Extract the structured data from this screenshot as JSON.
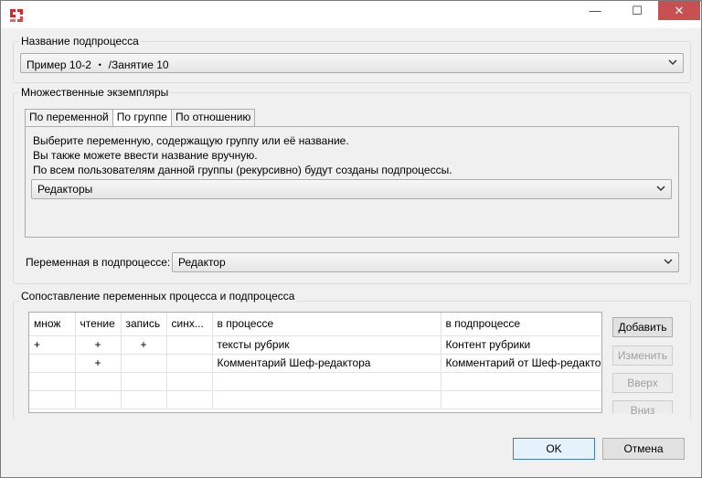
{
  "window": {
    "icon": "app-logo-icon",
    "controls": {
      "minimize": "—",
      "maximize": "☐",
      "close": "✕"
    }
  },
  "subprocess_name": {
    "title": "Название подпроцесса",
    "value": "Пример 10-2  ・ /Занятие 10"
  },
  "multi_instances": {
    "title": "Множественные экземпляры",
    "tabs": [
      "По переменной",
      "По группе",
      "По отношению"
    ],
    "active_tab": "По группе",
    "text_lines": [
      "Выберите переменную, содержащую группу или её название.",
      "Вы также можете ввести название вручную.",
      "По всем пользователям данной группы (рекурсивно) будут созданы подпроцессы."
    ],
    "group_value": "Редакторы",
    "variable_label": "Переменная в подпроцессе:",
    "variable_value": "Редактор"
  },
  "mapping": {
    "title": "Сопоставление переменных процесса и подпроцесса",
    "columns": [
      "множ",
      "чтение",
      "запись",
      "синх...",
      "в процессе",
      "в подпроцессе"
    ],
    "rows": [
      [
        "+",
        "+",
        "+",
        "",
        "тексты рубрик",
        "Контент рубрики"
      ],
      [
        "",
        "+",
        "",
        "",
        "Комментарий Шеф-редактора",
        "Комментарий от Шеф-редактор"
      ],
      [
        "",
        "",
        "",
        "",
        "",
        ""
      ],
      [
        "",
        "",
        "",
        "",
        "",
        ""
      ]
    ],
    "buttons": {
      "add": "Добавить",
      "edit": "Изменить",
      "up": "Вверх",
      "down": "Вниз"
    }
  },
  "footer": {
    "ok": "OK",
    "cancel": "Отмена"
  },
  "colors": {
    "close_button": "#c75050",
    "default_button_border": "#3c7fb1"
  }
}
